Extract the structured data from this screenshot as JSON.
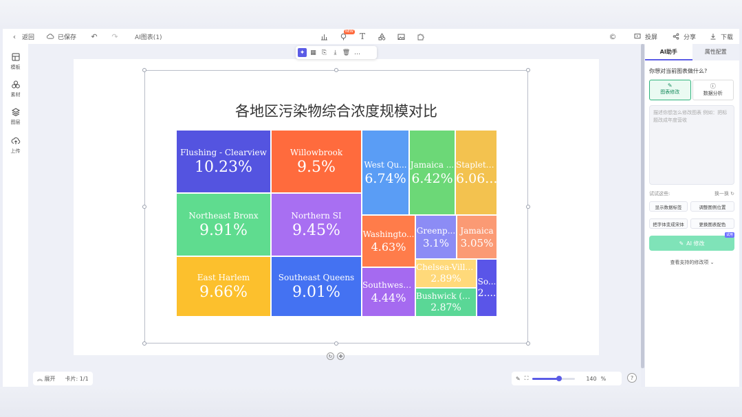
{
  "topbar": {
    "back_label": "返回",
    "saved_label": "已保存",
    "doc_title": "AI图表(1)",
    "new_badge": "NEW",
    "present_label": "投屏",
    "share_label": "分享",
    "download_label": "下载"
  },
  "left_rail": [
    {
      "label": "模板",
      "icon": "template-icon"
    },
    {
      "label": "素材",
      "icon": "assets-icon"
    },
    {
      "label": "图层",
      "icon": "layers-icon"
    },
    {
      "label": "上传",
      "icon": "upload-icon"
    }
  ],
  "chart_data": {
    "type": "treemap",
    "title": "各地区污染物综合浓度规模对比",
    "unit": "%",
    "items": [
      {
        "name": "Flushing - Clearview",
        "value": 10.23,
        "value_label": "10.23%",
        "name_label": "Flushing - Clearview",
        "color": "#5454e0"
      },
      {
        "name": "Northeast Bronx",
        "value": 9.91,
        "value_label": "9.91%",
        "name_label": "Northeast Bronx",
        "color": "#5fdc8f"
      },
      {
        "name": "East Harlem",
        "value": 9.66,
        "value_label": "9.66%",
        "name_label": "East Harlem",
        "color": "#fcc02d"
      },
      {
        "name": "Willowbrook",
        "value": 9.5,
        "value_label": "9.5%",
        "name_label": "Willowbrook",
        "color": "#ff6b3d"
      },
      {
        "name": "Northern SI",
        "value": 9.45,
        "value_label": "9.45%",
        "name_label": "Northern SI",
        "color": "#a86ff2"
      },
      {
        "name": "Southeast Queens",
        "value": 9.01,
        "value_label": "9.01%",
        "name_label": "Southeast Queens",
        "color": "#4472f2"
      },
      {
        "name": "West Queens",
        "value": 6.74,
        "value_label": "6.74%",
        "name_label": "West Qu...",
        "color": "#5a9df5"
      },
      {
        "name": "Jamaica",
        "value": 6.42,
        "value_label": "6.42%",
        "name_label": "Jamaica ...",
        "color": "#6cd877"
      },
      {
        "name": "Stapleton",
        "value": 6.06,
        "value_label": "6.06...",
        "name_label": "Stapleto...",
        "color": "#f3c24f"
      },
      {
        "name": "Washington Heights",
        "value": 4.63,
        "value_label": "4.63%",
        "name_label": "Washingto...",
        "color": "#ff7c4a"
      },
      {
        "name": "Southwest Queens",
        "value": 4.44,
        "value_label": "4.44%",
        "name_label": "Southwest ...",
        "color": "#a56af0"
      },
      {
        "name": "Greenpoint",
        "value": 3.1,
        "value_label": "3.1%",
        "name_label": "Greenp...",
        "color": "#8c8cf5"
      },
      {
        "name": "Jamaica",
        "value": 3.05,
        "value_label": "3.05%",
        "name_label": "Jamaica",
        "color": "#fb9a74"
      },
      {
        "name": "Chelsea - Village",
        "value": 2.89,
        "value_label": "2.89%",
        "name_label": "Chelsea-Villa...",
        "color": "#ffd97a"
      },
      {
        "name": "Bushwick (CD...)",
        "value": 2.87,
        "value_label": "2.87%",
        "name_label": "Bushwick (CD...",
        "color": "#5ad796"
      },
      {
        "name": "South",
        "value": 2.0,
        "value_label": "2....",
        "name_label": "So...",
        "color": "#5a55e8"
      }
    ]
  },
  "bottom": {
    "expand_label": "展开",
    "card_label": "卡片: 1/1",
    "zoom_value": "140",
    "zoom_unit": "%",
    "zoom_level": 0.62
  },
  "right_panel": {
    "tab_ai": "AI助手",
    "tab_props": "属性配置",
    "question": "你想对当前图表做什么?",
    "mode_edit": "图表修改",
    "mode_analyze": "数据分析",
    "placeholder": "描述你想怎么修改图表  例如：把标题改成年度营收",
    "try_label": "试试这些:",
    "refresh_label": "换一换",
    "suggestions": [
      "显示数据标签",
      "调整图例位置",
      "把字体变成宋体",
      "更换图表配色"
    ],
    "ai_button": "AI 修改",
    "ai_badge": "试用",
    "supported_label": "查看支持的修改项"
  }
}
